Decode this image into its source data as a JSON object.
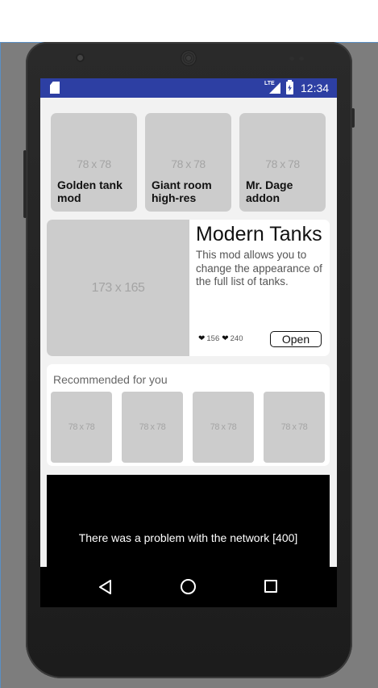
{
  "status_bar": {
    "network": "LTE",
    "time": "12:34",
    "color": "#2d3fa3"
  },
  "featured_mods": [
    {
      "placeholder": "78 x 78",
      "title": "Golden tank mod"
    },
    {
      "placeholder": "78 x 78",
      "title": "Giant room high-res"
    },
    {
      "placeholder": "78 x 78",
      "title": "Mr. Dage addon"
    }
  ],
  "feature_card": {
    "image_placeholder": "173 x 165",
    "title": "Modern Tanks",
    "description": "This mod allows you to change the appearance of the full list of tanks.",
    "likes": "156",
    "favorites": "240",
    "open_label": "Open"
  },
  "recommended": {
    "title": "Recommended for you",
    "items": [
      {
        "placeholder": "78 x 78"
      },
      {
        "placeholder": "78 x 78"
      },
      {
        "placeholder": "78 x 78"
      },
      {
        "placeholder": "78 x 78"
      }
    ]
  },
  "error": {
    "message": "There was a problem with the network [400]"
  },
  "nav_bar": {
    "buttons": [
      "back-icon",
      "home-icon",
      "recents-icon"
    ]
  }
}
